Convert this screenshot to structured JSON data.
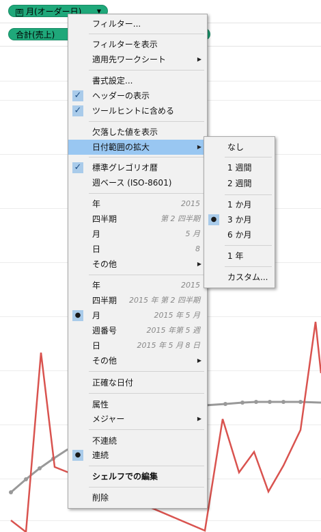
{
  "shelves": {
    "columns_pill": "月(オーダー日)",
    "columns_pill_expand": "⊞",
    "rows_pill": "合計(売上)"
  },
  "menu": {
    "filter": "フィルター...",
    "show_filter": "フィルターを表示",
    "apply_to": "適用先ワークシート",
    "format": "書式設定...",
    "show_header": "ヘッダーの表示",
    "include_tooltip": "ツールヒントに含める",
    "show_missing": "欠落した値を表示",
    "extend_date": "日付範囲の拡大",
    "gregorian": "標準グレゴリオ暦",
    "iso_week": "週ベース (ISO-8601)",
    "discrete": {
      "year": {
        "label": "年",
        "value": "2015"
      },
      "quarter": {
        "label": "四半期",
        "value": "第 2 四半期"
      },
      "month": {
        "label": "月",
        "value": "5 月"
      },
      "day": {
        "label": "日",
        "value": "8"
      },
      "other": "その他"
    },
    "continuous": {
      "year": {
        "label": "年",
        "value": "2015"
      },
      "quarter": {
        "label": "四半期",
        "value": "2015 年 第 2 四半期"
      },
      "month": {
        "label": "月",
        "value": "2015 年 5 月"
      },
      "week": {
        "label": "週番号",
        "value": "2015 年第 5 週"
      },
      "day": {
        "label": "日",
        "value": "2015 年 5 月 8 日"
      },
      "other": "その他"
    },
    "exact_date": "正確な日付",
    "attribute": "属性",
    "measure": "メジャー",
    "discrete_opt": "不連続",
    "continuous_opt": "連続",
    "edit_in_shelf": "シェルフでの編集",
    "remove": "削除"
  },
  "submenu": {
    "none": "なし",
    "week1": "1 週間",
    "week2": "2 週間",
    "month1": "1 か月",
    "month3": "3 か月",
    "month6": "6 か月",
    "year1": "1 年",
    "custom": "カスタム..."
  },
  "glyphs": {
    "check": "✓",
    "dot": "●",
    "submenu_arrow": "▶",
    "dropdown_arrow": "▼"
  },
  "colors": {
    "pill_green": "#1fa87a",
    "highlight_blue": "#99c7f2",
    "line_red": "#d9534f",
    "line_grey": "#999999"
  }
}
